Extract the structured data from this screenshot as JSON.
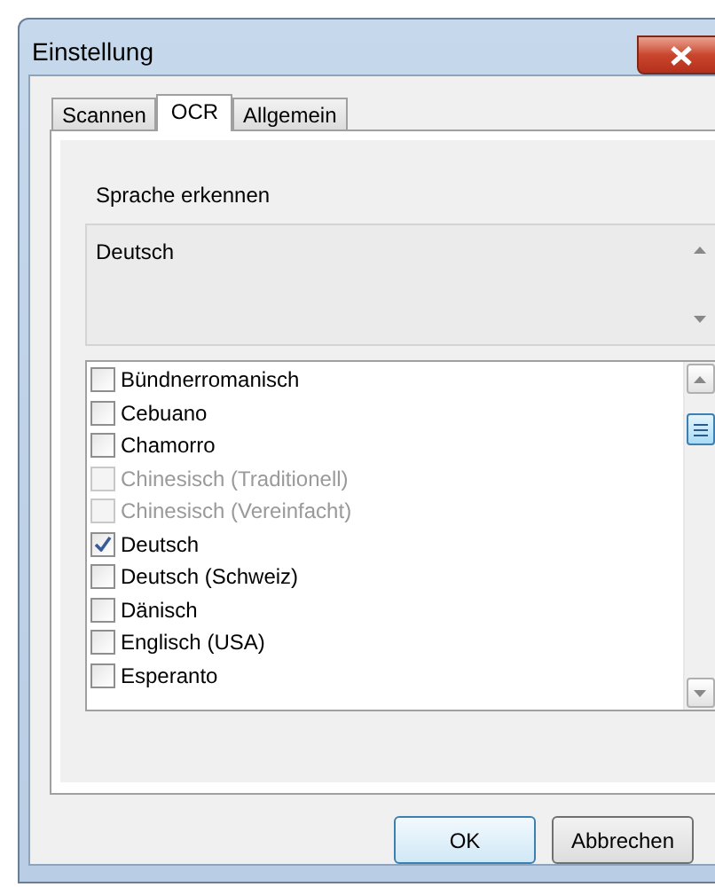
{
  "window": {
    "title": "Einstellung"
  },
  "tabs": [
    {
      "label": "Scannen",
      "selected": false
    },
    {
      "label": "OCR",
      "selected": true
    },
    {
      "label": "Allgemein",
      "selected": false
    }
  ],
  "section_label": "Sprache erkennen",
  "selected_languages": {
    "value": "Deutsch"
  },
  "languages": [
    {
      "label": "Bündnerromanisch",
      "checked": false,
      "disabled": false
    },
    {
      "label": "Cebuano",
      "checked": false,
      "disabled": false
    },
    {
      "label": "Chamorro",
      "checked": false,
      "disabled": false
    },
    {
      "label": "Chinesisch (Traditionell)",
      "checked": false,
      "disabled": true
    },
    {
      "label": "Chinesisch (Vereinfacht)",
      "checked": false,
      "disabled": true
    },
    {
      "label": "Deutsch",
      "checked": true,
      "disabled": false
    },
    {
      "label": "Deutsch (Schweiz)",
      "checked": false,
      "disabled": false
    },
    {
      "label": "Dänisch",
      "checked": false,
      "disabled": false
    },
    {
      "label": "Englisch (USA)",
      "checked": false,
      "disabled": false
    },
    {
      "label": "Esperanto",
      "checked": false,
      "disabled": false
    }
  ],
  "buttons": [
    {
      "label": "OK",
      "kind": "default"
    },
    {
      "label": "Abbrechen",
      "kind": "normal"
    }
  ]
}
